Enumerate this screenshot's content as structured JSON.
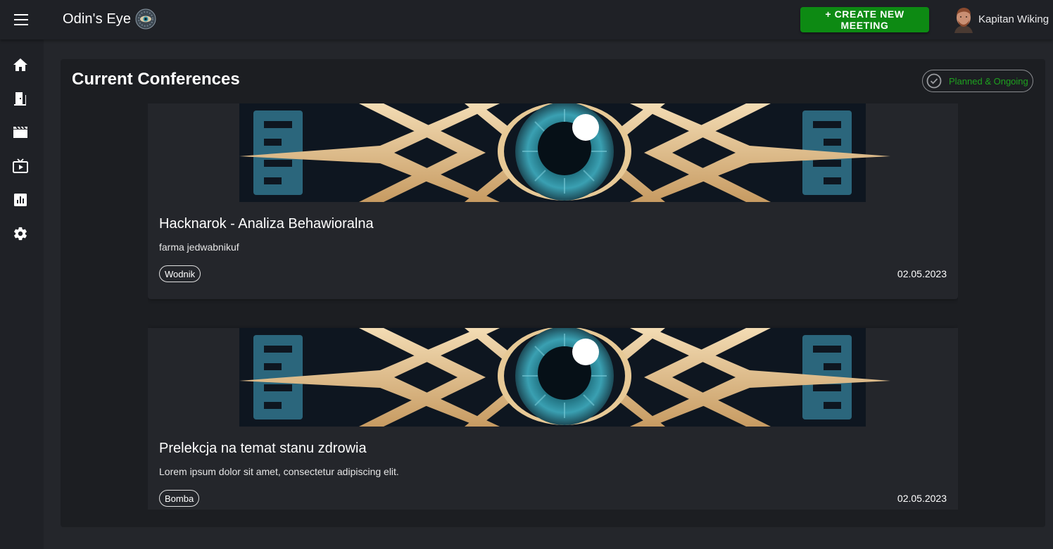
{
  "app": {
    "title": "Odin's Eye",
    "create_button": "+ CREATE NEW MEETING",
    "user_name": "Kapitan Wiking",
    "accent_color": "#0d8a13"
  },
  "sidebar": {
    "items": [
      {
        "icon": "home-icon"
      },
      {
        "icon": "door-icon"
      },
      {
        "icon": "clapperboard-icon"
      },
      {
        "icon": "live-tv-icon"
      },
      {
        "icon": "analytics-icon"
      },
      {
        "icon": "gear-icon"
      }
    ]
  },
  "main": {
    "title": "Current Conferences",
    "filter_chip": "Planned & Ongoing",
    "cards": [
      {
        "title": "Hacknarok - Analiza Behawioralna",
        "description": "farma jedwabnikuf",
        "tag": "Wodnik",
        "date": "02.05.2023"
      },
      {
        "title": "Prelekcja na temat stanu zdrowia",
        "description": "Lorem ipsum dolor sit amet, consectetur adipiscing elit.",
        "tag": "Bomba",
        "date": "02.05.2023"
      }
    ]
  }
}
